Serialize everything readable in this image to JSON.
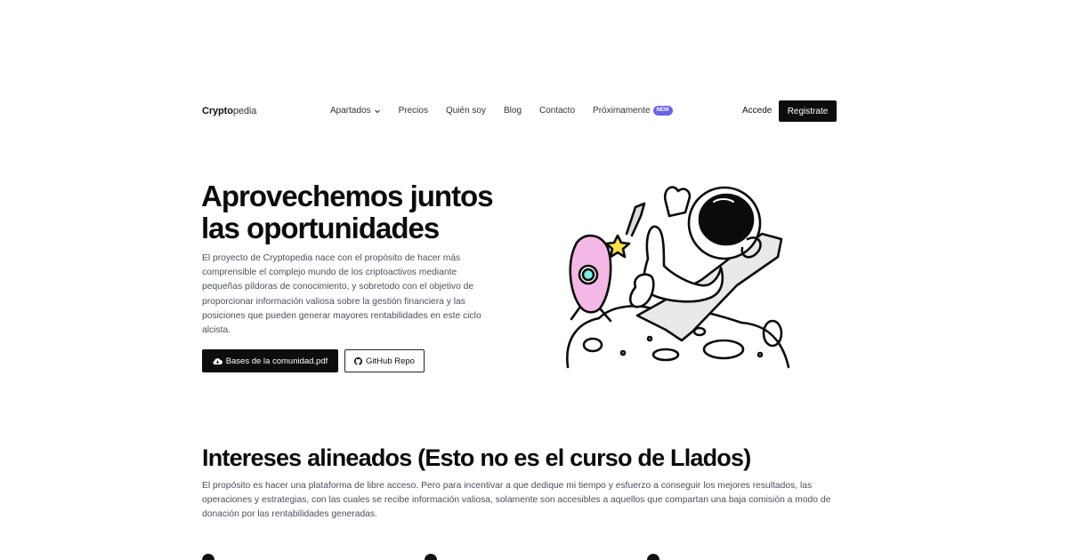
{
  "nav": {
    "logo_bold": "Crypto",
    "logo_light": "pedia",
    "items": [
      {
        "label": "Apartados"
      },
      {
        "label": "Precios"
      },
      {
        "label": "Quién soy"
      },
      {
        "label": "Blog"
      },
      {
        "label": "Contacto"
      },
      {
        "label": "Próximamente"
      }
    ],
    "badge": "NEW",
    "login": "Accede",
    "register": "Registrate"
  },
  "hero": {
    "title_line1": "Aprovechemos juntos",
    "title_line2": "las oportunidades",
    "text": "El proyecto de Cryptopedia nace con el propósito de hacer más comprensible el complejo mundo de los criptoactivos mediante pequeñas píldoras de conocimiento, y sobretodo con el objetivo de proporcionar información valiosa sobre la gestión financiera y las posiciones que pueden generar mayores rentabilidades en este ciclo alcista.",
    "btn_pdf": "Bases de la comunidad.pdf",
    "btn_github": "GitHub Repo"
  },
  "section": {
    "title": "Intereses alineados (Esto no es el curso de Llados)",
    "text": "El propósito es hacer una plataforma de libre acceso. Pero para incentivar a que dedique mi tiempo y esfuerzo a conseguir los mejores resultados, las operaciones y estrategias, con las cuales se recibe información valiosa, solamente son accesibles a aquellos que compartan una baja comisión a modo de donación por las rentabilidades generadas."
  },
  "colors": {
    "badge": "#6b63e6",
    "primary": "#0d0d0d",
    "rocket": "#f4b8e6",
    "star": "#ffe14d",
    "porthole": "#7ff0e8"
  }
}
